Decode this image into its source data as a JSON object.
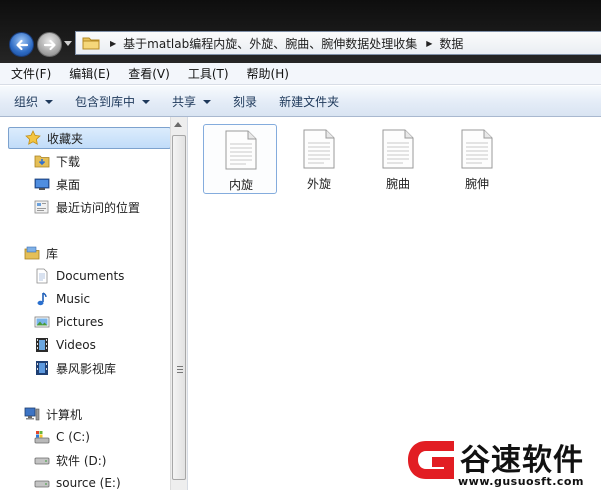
{
  "address": {
    "segments": [
      "基于matlab编程内旋、外旋、腕曲、腕伸数据处理收集",
      "数据"
    ]
  },
  "menu": [
    "文件(F)",
    "编辑(E)",
    "查看(V)",
    "工具(T)",
    "帮助(H)"
  ],
  "toolbar": {
    "organize": "组织",
    "include_library": "包含到库中",
    "share": "共享",
    "burn": "刻录",
    "new_folder": "新建文件夹"
  },
  "nav": {
    "favorites": "收藏夹",
    "downloads": "下载",
    "desktop": "桌面",
    "recent": "最近访问的位置",
    "libraries": "库",
    "documents": "Documents",
    "music": "Music",
    "pictures": "Pictures",
    "videos": "Videos",
    "storm": "暴风影视库",
    "computer": "计算机",
    "drive_c": "C (C:)",
    "drive_d": "软件 (D:)",
    "drive_e": "source (E:)"
  },
  "files": [
    "内旋",
    "外旋",
    "腕曲",
    "腕伸"
  ],
  "watermark": {
    "title": "谷速软件",
    "url": "www.gusuosft.com"
  },
  "colors": {
    "accent": "#1e395b",
    "selection": "#c1dcf9",
    "watermark_red": "#e21d23"
  }
}
